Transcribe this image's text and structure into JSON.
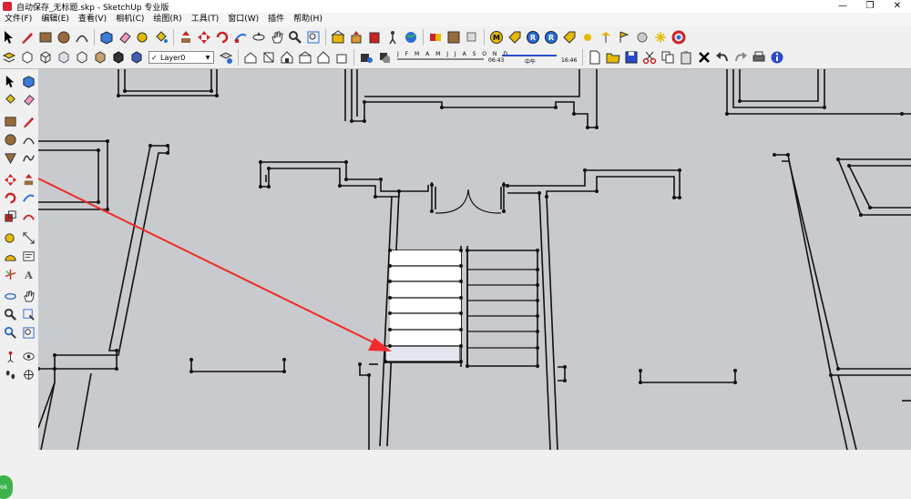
{
  "window": {
    "title": "自动保存_无标题.skp - SketchUp 专业版",
    "controls": [
      "—",
      "❐",
      "✕"
    ]
  },
  "menu": [
    "文件(F)",
    "编辑(E)",
    "查看(V)",
    "相机(C)",
    "绘图(R)",
    "工具(T)",
    "窗口(W)",
    "插件",
    "帮助(H)"
  ],
  "layer": {
    "name": "Layer0",
    "checked": "✓"
  },
  "shadow": {
    "months": "J F M A M J J A S O N D",
    "time_start": "06:43",
    "time_mid": "中午",
    "time_end": "16:46"
  },
  "status": {
    "badge": "66"
  },
  "colors": {
    "viewport_bg": "#c8cacd",
    "annotation_arrow": "#ee2b2b",
    "brand_green": "#3cb44b"
  }
}
